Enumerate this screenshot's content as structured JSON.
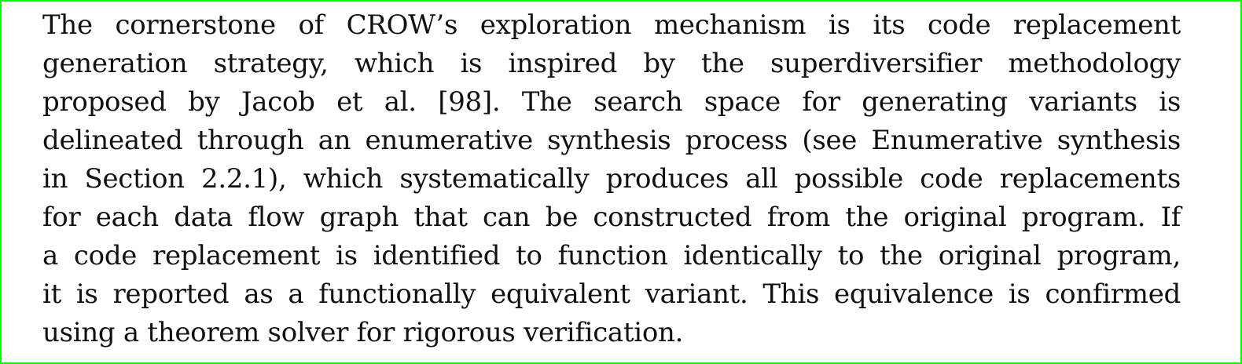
{
  "paragraph": {
    "lines": [
      "The cornerstone of CROW’s exploration mechanism is its code replacement",
      "generation strategy, which is inspired by the superdiversifier methodology",
      "proposed by Jacob et al. [98]. The search space for generating variants is",
      "delineated through an enumerative synthesis process (see Enumerative synthesis",
      "in Section 2.2.1), which systematically produces all possible code replacements",
      "for each data flow graph that can be constructed from the original program. If",
      "a code replacement is identified to function identically to the original program,",
      "it is reported as a functionally equivalent variant. This equivalence is confirmed",
      "using a theorem solver for rigorous verification."
    ]
  },
  "colors": {
    "frame_border": "#00ff00",
    "text": "#111111",
    "background": "#ffffff"
  }
}
